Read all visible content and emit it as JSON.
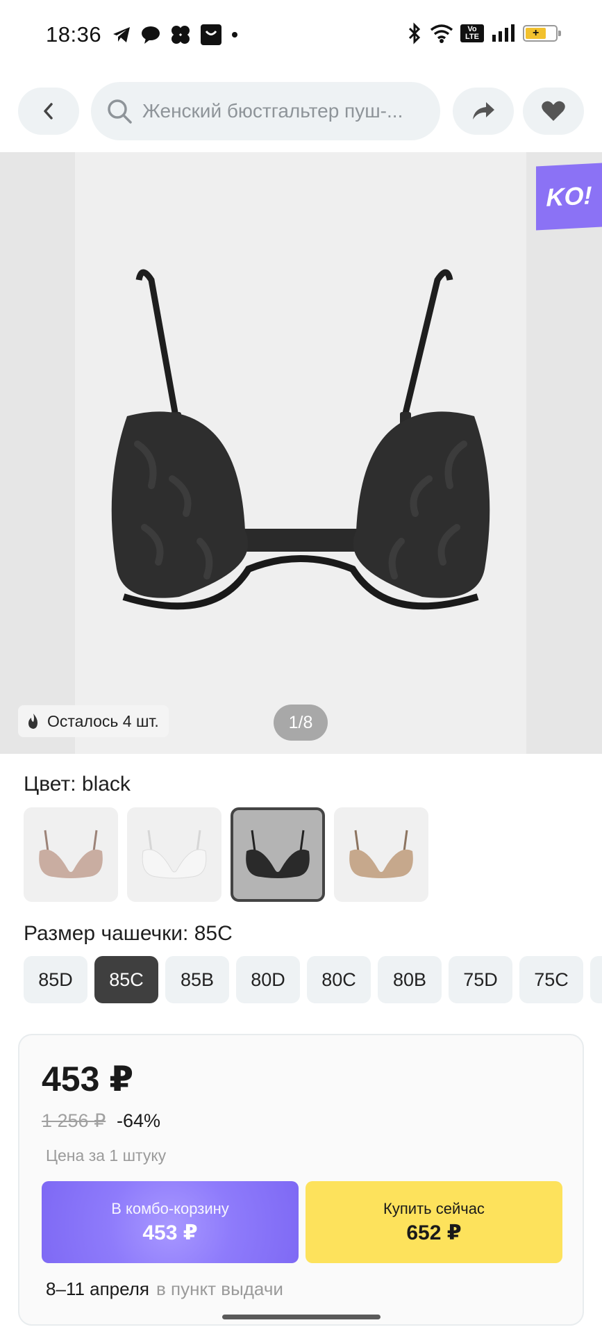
{
  "status_bar": {
    "time": "18:36",
    "volte_label": "Vo LTE",
    "app_icons": [
      "telegram-icon",
      "chat-bubble-icon",
      "cluster-app-icon",
      "shop-bag-icon",
      "dot-icon"
    ],
    "system_icons": [
      "bluetooth-icon",
      "wifi-icon",
      "volte-icon",
      "signal-icon",
      "battery-icon"
    ],
    "battery_level": 0.7
  },
  "nav": {
    "search_text": "Женский бюстгальтер пуш-..."
  },
  "gallery": {
    "promo_badge": "KO!",
    "stock_text": "Осталось 4 шт.",
    "pager": "1/8"
  },
  "color": {
    "label": "Цвет: black",
    "swatches": [
      {
        "name": "beige",
        "color": "#c9ada1"
      },
      {
        "name": "white",
        "color": "#e9e9e9"
      },
      {
        "name": "black",
        "color": "#2a2a2a",
        "selected": true
      },
      {
        "name": "nude",
        "color": "#c6a88c"
      }
    ]
  },
  "size": {
    "label": "Размер чашечки: 85C",
    "options": [
      "85D",
      "85C",
      "85B",
      "80D",
      "80C",
      "80B",
      "75D",
      "75C"
    ],
    "selected": "85C"
  },
  "price": {
    "current": "453 ₽",
    "old": "1 256 ₽",
    "discount": "-64%",
    "note": "Цена за 1 штуку"
  },
  "actions": {
    "combo_label": "В комбо-корзину",
    "combo_price": "453 ₽",
    "buy_label": "Купить сейчас",
    "buy_price": "652 ₽"
  },
  "delivery": {
    "dates": "8–11 апреля",
    "place": "в пункт выдачи"
  },
  "colors": {
    "combo_button": "#8e7bfb",
    "buy_button": "#fde25c",
    "promo_badge": "#8b72f5"
  }
}
